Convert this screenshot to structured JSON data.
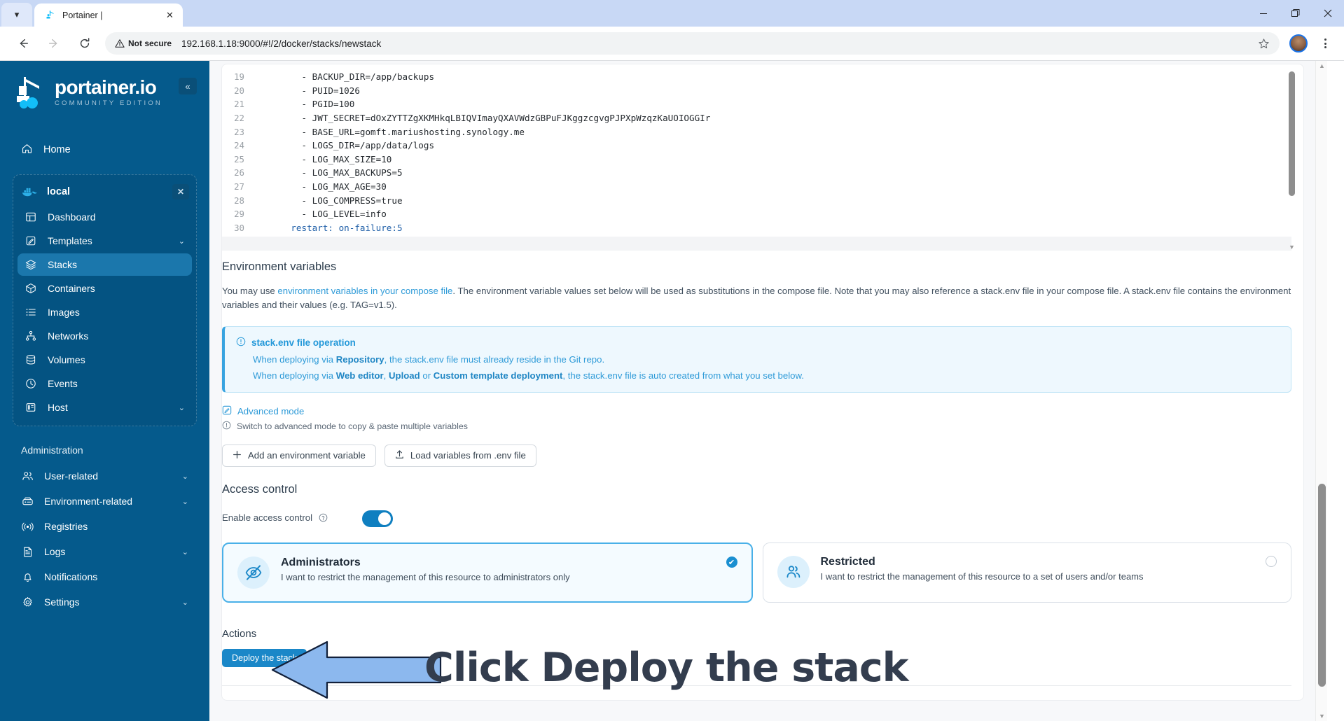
{
  "browser": {
    "tab_chevron_icon": "chevron-down-icon",
    "tab": {
      "title": "Portainer |",
      "favicon": "portainer-favicon",
      "close_label": "✕"
    },
    "window_controls": {
      "minimize": "—",
      "maximize": "❐",
      "close": "✕"
    },
    "back_icon": "←",
    "forward_icon": "→",
    "reload_icon": "⟳",
    "security_label": "Not secure",
    "url": "192.168.1.18:9000/#!/2/docker/stacks/newstack",
    "bookmark_icon": "star-icon",
    "profile_icon": "avatar",
    "menu_icon": "kebab-menu-icon"
  },
  "sidebar": {
    "brand_name": "portainer.io",
    "brand_sub": "COMMUNITY EDITION",
    "collapse_label": "«",
    "home": {
      "label": "Home",
      "icon": "home-icon"
    },
    "environment": {
      "name": "local",
      "icon": "docker-icon",
      "close_label": "✕"
    },
    "env_items": [
      {
        "label": "Dashboard",
        "icon": "dashboard-icon",
        "chevron": "",
        "active": false
      },
      {
        "label": "Templates",
        "icon": "templates-icon",
        "chevron": "⌄",
        "active": false
      },
      {
        "label": "Stacks",
        "icon": "stacks-icon",
        "chevron": "",
        "active": true
      },
      {
        "label": "Containers",
        "icon": "containers-icon",
        "chevron": "",
        "active": false
      },
      {
        "label": "Images",
        "icon": "images-icon",
        "chevron": "",
        "active": false
      },
      {
        "label": "Networks",
        "icon": "networks-icon",
        "chevron": "",
        "active": false
      },
      {
        "label": "Volumes",
        "icon": "volumes-icon",
        "chevron": "",
        "active": false
      },
      {
        "label": "Events",
        "icon": "events-icon",
        "chevron": "",
        "active": false
      },
      {
        "label": "Host",
        "icon": "host-icon",
        "chevron": "⌄",
        "active": false
      }
    ],
    "admin_title": "Administration",
    "admin_items": [
      {
        "label": "User-related",
        "icon": "users-icon",
        "chevron": "⌄"
      },
      {
        "label": "Environment-related",
        "icon": "environment-icon",
        "chevron": "⌄"
      },
      {
        "label": "Registries",
        "icon": "registries-icon",
        "chevron": ""
      },
      {
        "label": "Logs",
        "icon": "logs-icon",
        "chevron": "⌄"
      },
      {
        "label": "Notifications",
        "icon": "bell-icon",
        "chevron": ""
      },
      {
        "label": "Settings",
        "icon": "gear-icon",
        "chevron": "⌄"
      }
    ]
  },
  "editor": {
    "lines": [
      {
        "n": "19",
        "text": "      - BACKUP_DIR=/app/backups"
      },
      {
        "n": "20",
        "text": "      - PUID=1026"
      },
      {
        "n": "21",
        "text": "      - PGID=100"
      },
      {
        "n": "22",
        "text": "      - JWT_SECRET=dOxZYTTZgXKMHkqLBIQVImayQXAVWdzGBPuFJKggzcgvgPJPXpWzqzKaUOIOGGIr"
      },
      {
        "n": "23",
        "text": "      - BASE_URL=gomft.mariushosting.synology.me"
      },
      {
        "n": "24",
        "text": "      - LOGS_DIR=/app/data/logs"
      },
      {
        "n": "25",
        "text": "      - LOG_MAX_SIZE=10"
      },
      {
        "n": "26",
        "text": "      - LOG_MAX_BACKUPS=5"
      },
      {
        "n": "27",
        "text": "      - LOG_MAX_AGE=30"
      },
      {
        "n": "28",
        "text": "      - LOG_COMPRESS=true"
      },
      {
        "n": "29",
        "text": "      - LOG_LEVEL=info"
      },
      {
        "n": "30",
        "text": "    restart: on-failure:5",
        "key": "restart"
      }
    ]
  },
  "env_section": {
    "title": "Environment variables",
    "desc_pre": "You may use ",
    "desc_link": "environment variables in your compose file",
    "desc_post": ". The environment variable values set below will be used as substitutions in the compose file. Note that you may also reference a stack.env file in your compose file. A stack.env file contains the environment variables and their values (e.g. TAG=v1.5).",
    "note": {
      "icon": "info-icon",
      "title": "stack.env file operation",
      "line1_pre": "When deploying via ",
      "line1_bold": "Repository",
      "line1_post": ", the stack.env file must already reside in the Git repo.",
      "line2_pre": "When deploying via ",
      "line2_bold1": "Web editor",
      "line2_mid1": ", ",
      "line2_bold2": "Upload",
      "line2_mid2": " or ",
      "line2_bold3": "Custom template deployment",
      "line2_post": ", the stack.env file is auto created from what you set below."
    },
    "advanced_mode": "Advanced mode",
    "advanced_icon": "edit-icon",
    "hint": "Switch to advanced mode to copy & paste multiple variables",
    "hint_icon": "info-icon",
    "add_var_button": "Add an environment variable",
    "add_var_icon": "plus-icon",
    "load_env_button": "Load variables from .env file",
    "load_env_icon": "upload-icon"
  },
  "access_control": {
    "title": "Access control",
    "toggle_label": "Enable access control",
    "toggle_help_icon": "question-icon",
    "toggle_on": true,
    "options": [
      {
        "title": "Administrators",
        "desc": "I want to restrict the management of this resource to administrators only",
        "icon": "eye-off-icon",
        "selected": true,
        "check_glyph": "✔"
      },
      {
        "title": "Restricted",
        "desc": "I want to restrict the management of this resource to a set of users and/or teams",
        "icon": "users-group-icon",
        "selected": false,
        "check_glyph": ""
      }
    ]
  },
  "actions": {
    "title": "Actions",
    "deploy_button": "Deploy the stack"
  },
  "annotation": {
    "text": "Click Deploy the stack",
    "arrow_icon": "left-arrow-annotation",
    "arrow_fill": "#8cb8ee",
    "arrow_stroke": "#12203a",
    "text_color": "#333d4e"
  },
  "colors": {
    "sidebar_bg": "#055a8c",
    "accent": "#1a87c8",
    "link": "#2f9bd8",
    "note_bg": "#eef8fe"
  }
}
